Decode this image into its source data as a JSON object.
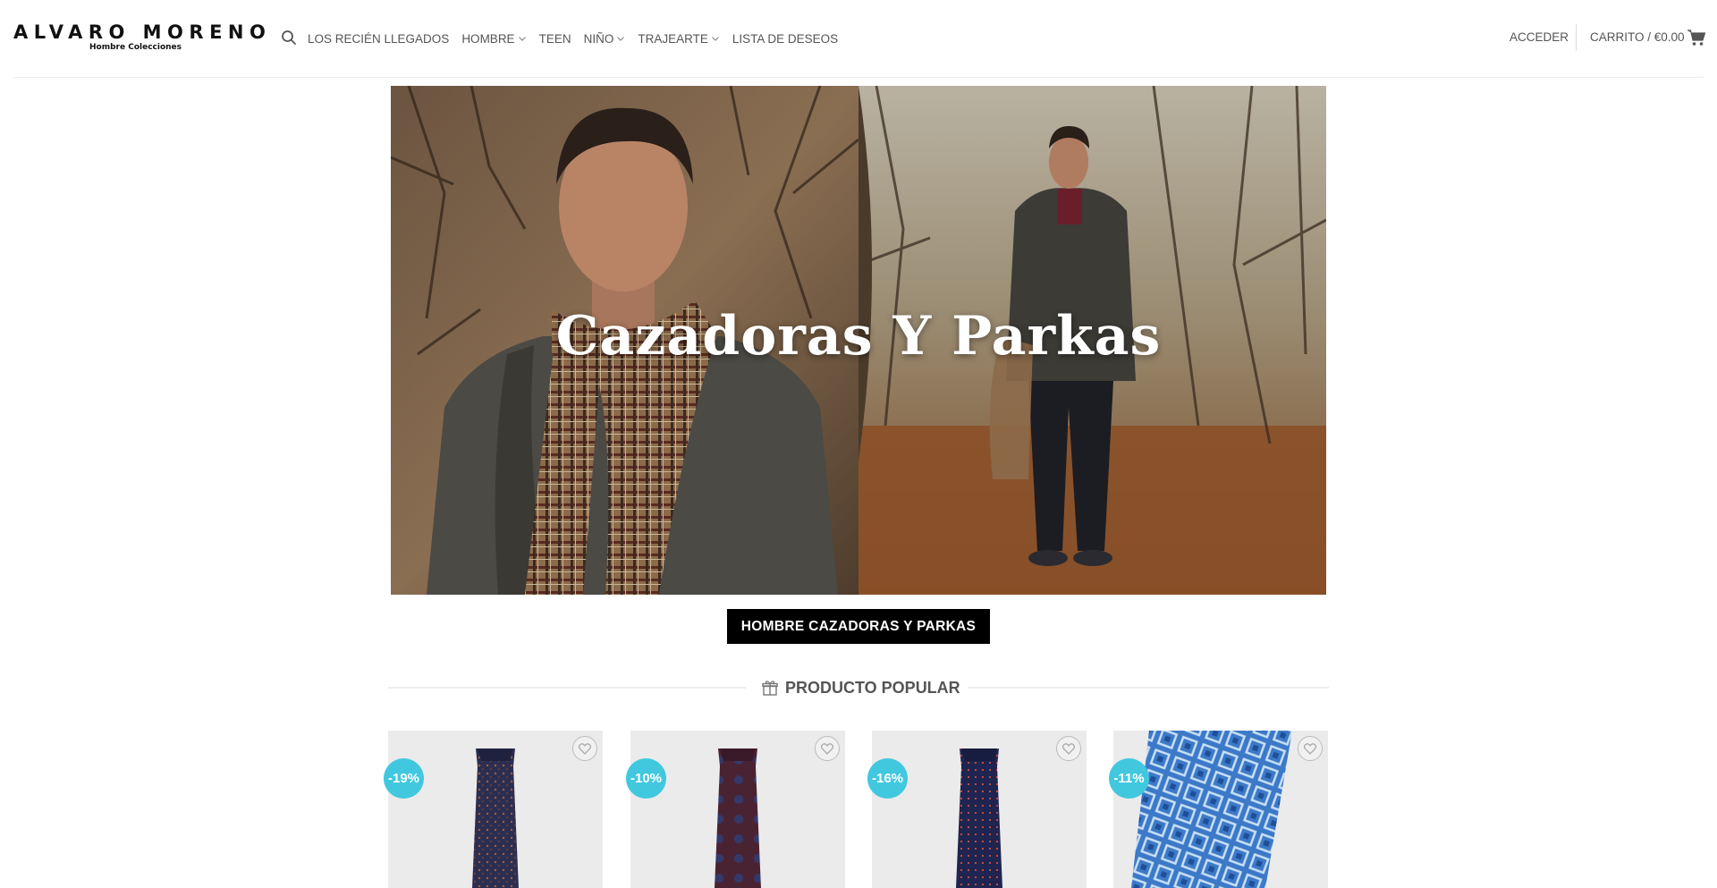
{
  "header": {
    "logo_text": "ALVARO MORENO",
    "logo_subtext": "Hombre Colecciones",
    "search_icon": "search-icon",
    "nav": [
      {
        "label": "LOS RECIÉN LLEGADOS",
        "dropdown": false
      },
      {
        "label": "HOMBRE",
        "dropdown": true
      },
      {
        "label": "TEEN",
        "dropdown": false
      },
      {
        "label": "NIÑO",
        "dropdown": true
      },
      {
        "label": "TRAJEARTE",
        "dropdown": true
      },
      {
        "label": "LISTA DE DESEOS",
        "dropdown": false
      }
    ],
    "login_label": "ACCEDER",
    "cart_label": "CARRITO / €0.00",
    "cart_icon": "shopping-cart-icon"
  },
  "hero": {
    "title": "Cazadoras Y Parkas",
    "button_label": "HOMBRE CAZADORAS Y PARKAS"
  },
  "popular": {
    "title": "PRODUCTO POPULAR",
    "icon": "gift-icon",
    "products": [
      {
        "discount": "-19%",
        "tie_color": "#2b2e52",
        "pattern_color": "#b35a2a",
        "wishlist_icon": "heart-icon"
      },
      {
        "discount": "-10%",
        "tie_color": "#4a2333",
        "pattern_color": "#2e3f7a",
        "wishlist_icon": "heart-icon"
      },
      {
        "discount": "-16%",
        "tie_color": "#1f2550",
        "pattern_color": "#c44a3a",
        "wishlist_icon": "heart-icon"
      },
      {
        "discount": "-11%",
        "tie_color": "#3c79c8",
        "pattern_color": "#c9e0f5",
        "wishlist_icon": "heart-icon"
      }
    ]
  },
  "colors": {
    "accent_badge": "#41c8df",
    "button_bg": "#000000",
    "text": "#555555"
  }
}
